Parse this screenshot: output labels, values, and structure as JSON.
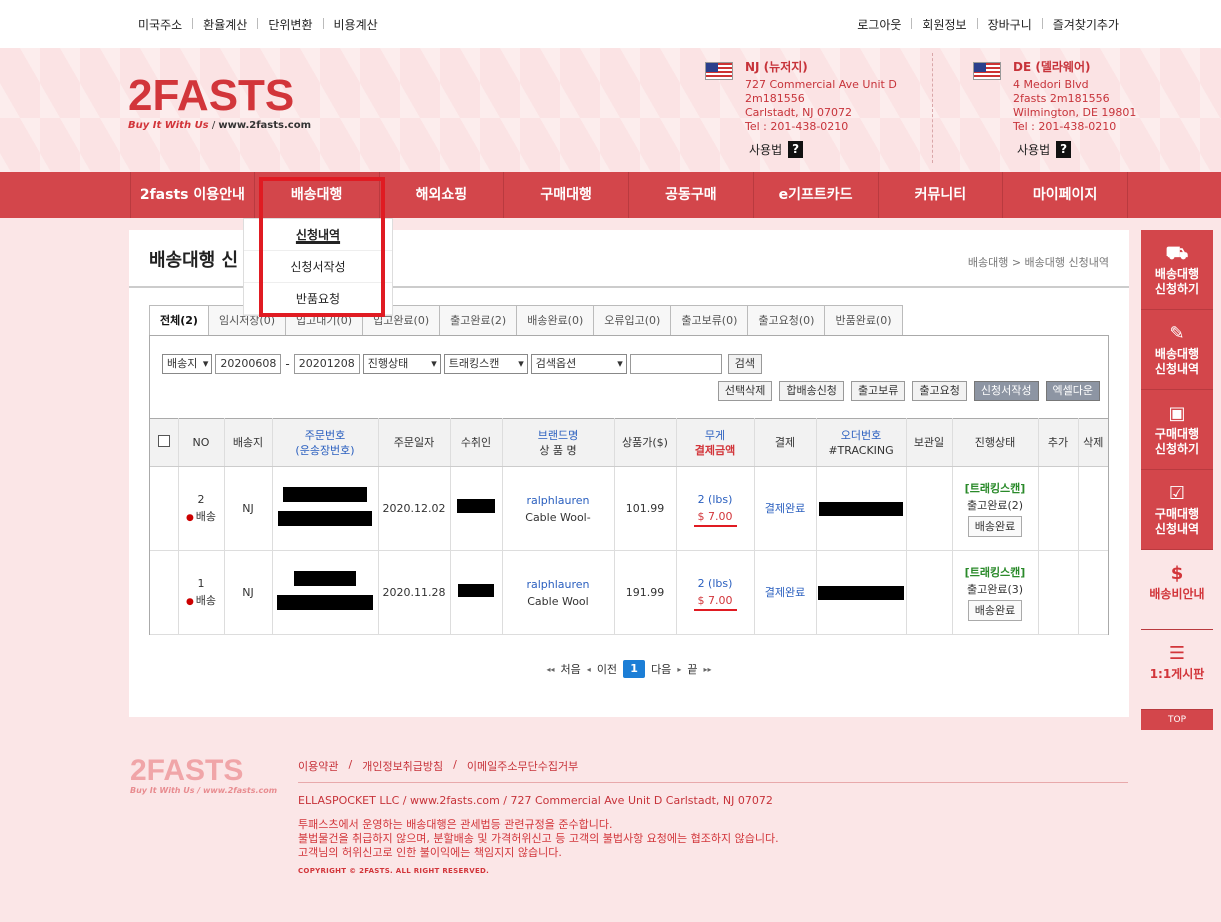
{
  "topbar": {
    "left": [
      "미국주소",
      "환율계산",
      "단위변환",
      "비용계산"
    ],
    "right": [
      "로그아웃",
      "회원정보",
      "장바구니",
      "즐겨찾기추가"
    ]
  },
  "logo": {
    "main": "2FASTS",
    "tagline": "Buy It With Us",
    "url": "www.2fasts.com"
  },
  "addresses": [
    {
      "title": "NJ (뉴저지)",
      "line1": "727 Commercial Ave Unit D",
      "line2": "2m181556",
      "line3": "Carlstadt,  NJ  07072",
      "line4": "Tel : 201-438-0210",
      "usage": "사용법",
      "q": "?"
    },
    {
      "title": "DE (델라웨어)",
      "line1": "4 Medori Blvd",
      "line2": "2fasts 2m181556",
      "line3": "Wilmington,  DE  19801",
      "line4": "Tel : 201-438-0210",
      "usage": "사용법",
      "q": "?"
    }
  ],
  "nav": [
    "2fasts 이용안내",
    "배송대행",
    "해외쇼핑",
    "구매대행",
    "공동구매",
    "e기프트카드",
    "커뮤니티",
    "마이페이지"
  ],
  "dropdown": [
    "신청내역",
    "신청서작성",
    "반품요청"
  ],
  "page": {
    "title": "배송대행 신",
    "breadcrumb": "배송대행 > 배송대행 신청내역"
  },
  "tabs": [
    "전체(2)",
    "임시저장(0)",
    "입고대기(0)",
    "입고완료(0)",
    "출고완료(2)",
    "배송완료(0)",
    "오류입고(0)",
    "출고보류(0)",
    "출고요청(0)",
    "반품완료(0)"
  ],
  "filters": {
    "dest": "배송지",
    "date_from": "20200608",
    "dash": "-",
    "date_to": "20201208",
    "status": "진행상태",
    "scan": "트래킹스캔",
    "option": "검색옵션",
    "search_value": "",
    "search_btn": "검색"
  },
  "actions": [
    "선택삭제",
    "합배송신청",
    "출고보류",
    "출고요청",
    "신청서작성",
    "엑셀다운"
  ],
  "table": {
    "headers": {
      "no": "NO",
      "dest": "배송지",
      "order_1": "주문번호",
      "order_2": "(운송장번호)",
      "date": "주문일자",
      "recipient": "수취인",
      "brand_1": "브랜드명",
      "brand_2": "상 품 명",
      "price": "상품가($)",
      "weight_1": "무게",
      "weight_2": "결제금액",
      "payment": "결제",
      "tracking_1": "오더번호",
      "tracking_2": "#TRACKING",
      "storage": "보관일",
      "status": "진행상태",
      "add": "추가",
      "delete": "삭제"
    },
    "rows": [
      {
        "no": "2",
        "type": "배송",
        "dest": "NJ",
        "date": "2020.12.02",
        "brand": "ralphlauren",
        "product": "Cable Wool-",
        "price": "101.99",
        "weight": "2 (lbs)",
        "amount": "$ 7.00",
        "payment": "결제완료",
        "scan": "[트래킹스캔]",
        "status": "출고완료(2)",
        "status_btn": "배송완료"
      },
      {
        "no": "1",
        "type": "배송",
        "dest": "NJ",
        "date": "2020.11.28",
        "brand": "ralphlauren",
        "product": "Cable Wool",
        "price": "191.99",
        "weight": "2 (lbs)",
        "amount": "$ 7.00",
        "payment": "결제완료",
        "scan": "[트래킹스캔]",
        "status": "출고완료(3)",
        "status_btn": "배송완료"
      }
    ]
  },
  "pager": {
    "first": "처음",
    "prev": "이전",
    "current": "1",
    "next": "다음",
    "last": "끝"
  },
  "sidebar": [
    {
      "icon": "truck-icon",
      "glyph": "🚚",
      "label1": "배송대행",
      "label2": "신청하기"
    },
    {
      "icon": "form-icon",
      "glyph": "✎",
      "label1": "배송대행",
      "label2": "신청내역"
    },
    {
      "icon": "bag-icon",
      "glyph": "🛍",
      "label1": "구매대행",
      "label2": "신청하기"
    },
    {
      "icon": "clipboard-icon",
      "glyph": "📋",
      "label1": "구매대행",
      "label2": "신청내역"
    },
    {
      "icon": "money-icon",
      "glyph": "💵",
      "label1": "배송비안내",
      "label2": ""
    },
    {
      "icon": "document-icon",
      "glyph": "📄",
      "label1": "1:1게시판",
      "label2": ""
    }
  ],
  "sidebar_top": "TOP",
  "footer": {
    "logo": "2FASTS",
    "tagline": "Buy It With Us / www.2fasts.com",
    "links": [
      "이용약관",
      "개인정보취급방침",
      "이메일주소무단수집거부"
    ],
    "address": "ELLASPOCKET LLC / www.2fasts.com / 727 Commercial Ave Unit D Carlstadt, NJ 07072",
    "notice1": "투패스츠에서 운영하는 배송대행은 관세법등 관련규정을 준수합니다.",
    "notice2": "불법물건을 취급하지 않으며, 분할배송 및 가격허위신고 등 고객의 불법사항 요청에는 협조하지 않습니다.",
    "notice3": "고객님의 허위신고로 인한 불이익에는 책임지지 않습니다.",
    "copyright": "COPYRIGHT © 2FASTS. ALL RIGHT RESERVED."
  },
  "colors": {
    "brand": "#d3464b",
    "accent": "#e01b22",
    "link": "#2a5fbf"
  }
}
